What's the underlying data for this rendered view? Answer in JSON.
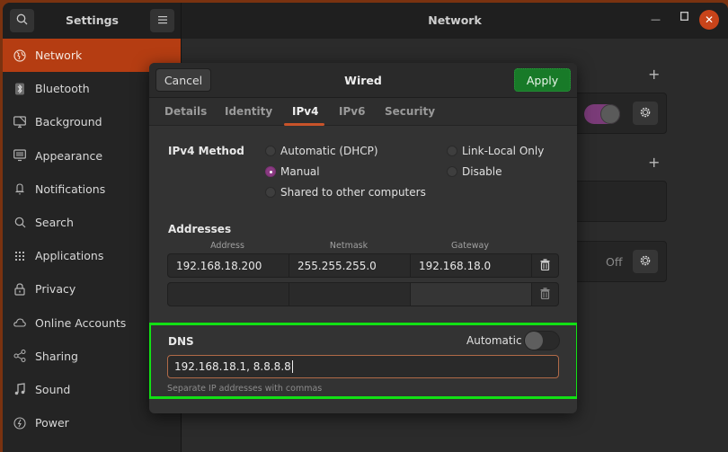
{
  "titlebar": {
    "app_title": "Settings",
    "page_title": "Network",
    "search_icon": "search-icon",
    "menu_icon": "hamburger-menu-icon",
    "window_controls": [
      "minimize",
      "maximize",
      "close"
    ],
    "close_glyph": "✕",
    "minimize_glyph": "—",
    "maximize_glyph": "☐"
  },
  "sidebar": {
    "items": [
      {
        "label": "Network",
        "icon": "globe-icon",
        "active": true
      },
      {
        "label": "Bluetooth",
        "icon": "bluetooth-icon"
      },
      {
        "label": "Background",
        "icon": "background-icon"
      },
      {
        "label": "Appearance",
        "icon": "appearance-icon"
      },
      {
        "label": "Notifications",
        "icon": "bell-icon"
      },
      {
        "label": "Search",
        "icon": "search-icon"
      },
      {
        "label": "Applications",
        "icon": "grid-icon"
      },
      {
        "label": "Privacy",
        "icon": "lock-icon"
      },
      {
        "label": "Online Accounts",
        "icon": "cloud-icon"
      },
      {
        "label": "Sharing",
        "icon": "share-icon"
      },
      {
        "label": "Sound",
        "icon": "music-note-icon"
      },
      {
        "label": "Power",
        "icon": "power-icon"
      }
    ]
  },
  "background_panel": {
    "add_glyph": "+",
    "wired_toggle_on": true,
    "off_label": "Off"
  },
  "dialog": {
    "title": "Wired",
    "cancel_label": "Cancel",
    "apply_label": "Apply",
    "tabs": [
      {
        "label": "Details"
      },
      {
        "label": "Identity"
      },
      {
        "label": "IPv4",
        "active": true
      },
      {
        "label": "IPv6"
      },
      {
        "label": "Security"
      }
    ],
    "ipv4_method": {
      "label": "IPv4 Method",
      "options": [
        {
          "label": "Automatic (DHCP)",
          "checked": false
        },
        {
          "label": "Manual",
          "checked": true
        },
        {
          "label": "Shared to other computers",
          "checked": false
        },
        {
          "label": "Link-Local Only",
          "checked": false
        },
        {
          "label": "Disable",
          "checked": false
        }
      ]
    },
    "addresses": {
      "label": "Addresses",
      "columns": [
        "Address",
        "Netmask",
        "Gateway"
      ],
      "rows": [
        [
          "192.168.18.200",
          "255.255.255.0",
          "192.168.18.0"
        ],
        [
          "",
          "",
          ""
        ]
      ],
      "delete_glyph": "🗑"
    },
    "dns": {
      "label": "DNS",
      "automatic_label": "Automatic",
      "automatic_on": false,
      "value": "192.168.18.1, 8.8.8.8",
      "hint": "Separate IP addresses with commas",
      "highlight_color": "#12e014"
    }
  },
  "colors": {
    "accent": "#b53d12",
    "apply": "#187a28",
    "radio_checked": "#8a3b82",
    "toggle_on": "#7a3b78"
  }
}
